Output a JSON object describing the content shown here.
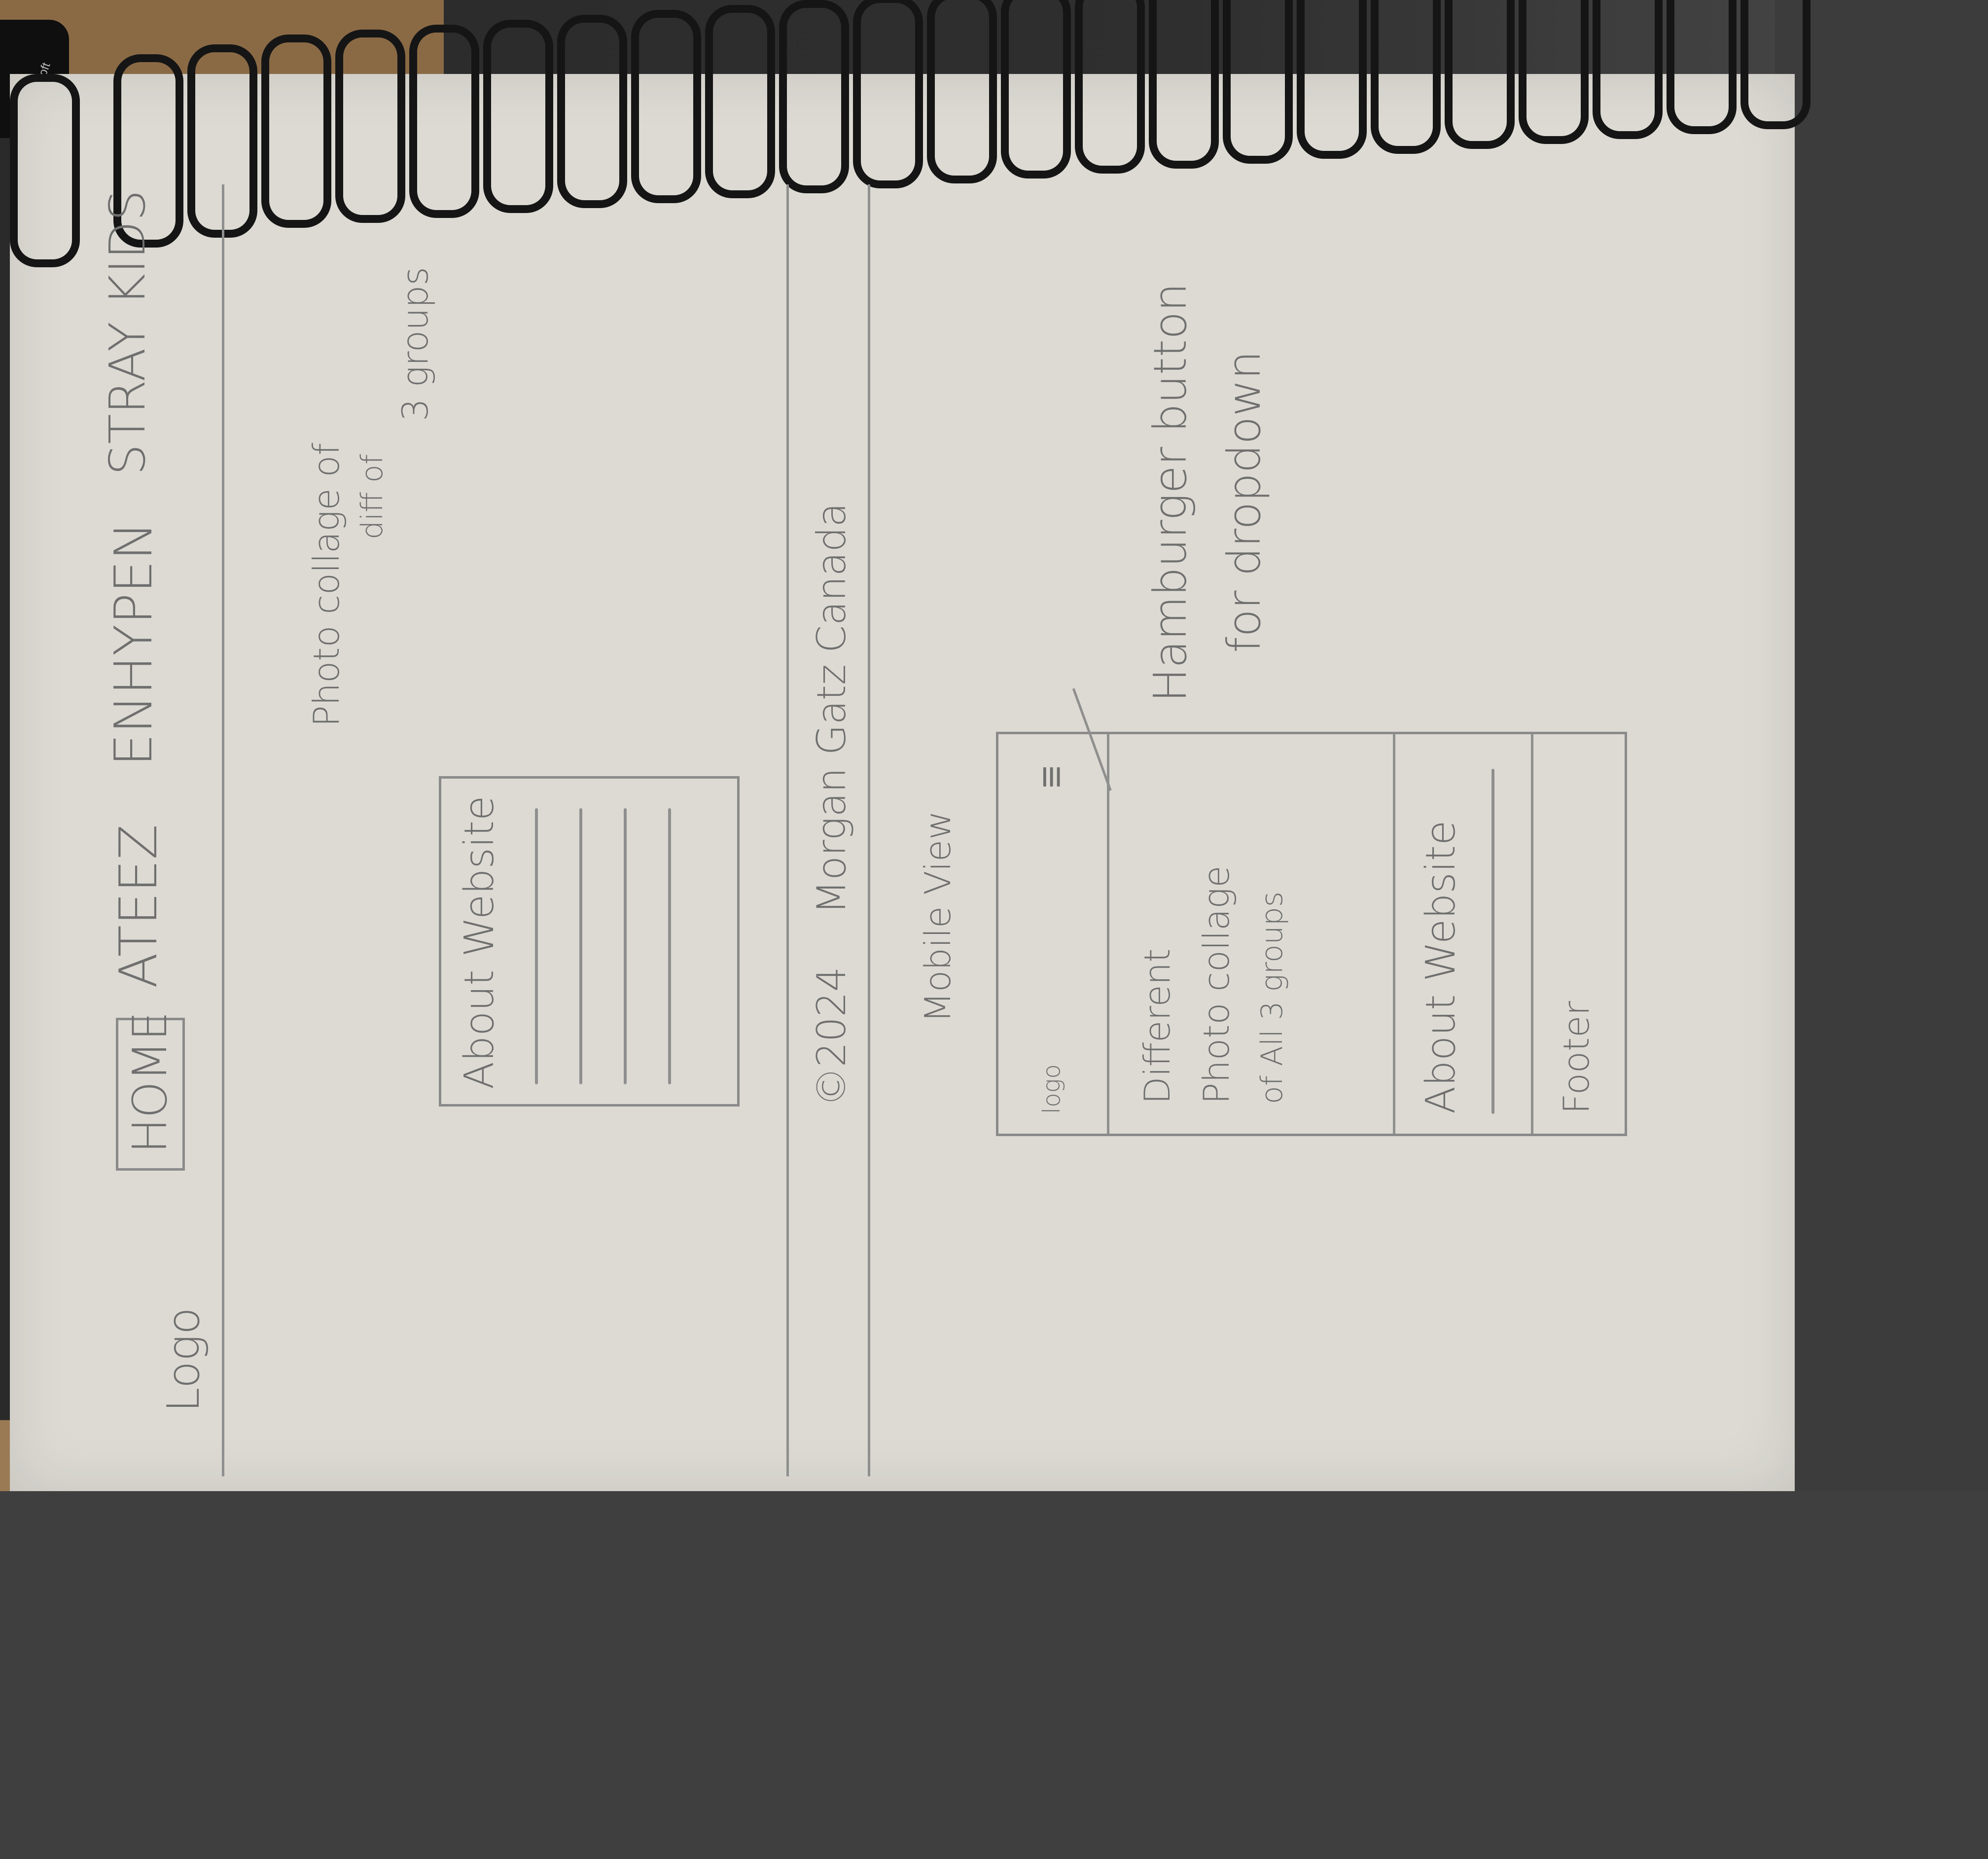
{
  "desktop": {
    "mouse_brand": "Microsoft"
  },
  "desktop_view": {
    "logo": "Logo",
    "nav": [
      "HOME",
      "ATEEZ",
      "ENHYPEN",
      "STRAY KIDS"
    ],
    "hero_note": [
      "Photo collage of",
      "diff of",
      "3 groups"
    ],
    "about_title": "About Website",
    "footer": [
      "©2024",
      "Morgan Gatz",
      "Canada"
    ]
  },
  "mobile_view": {
    "label": "Mobile View",
    "logo": "logo",
    "hamburger_note": [
      "Hamburger button",
      "for dropdown"
    ],
    "collage_note": [
      "Different",
      "Photo collage",
      "of All 3 groups"
    ],
    "about_title": "About Website",
    "footer": "Footer"
  }
}
